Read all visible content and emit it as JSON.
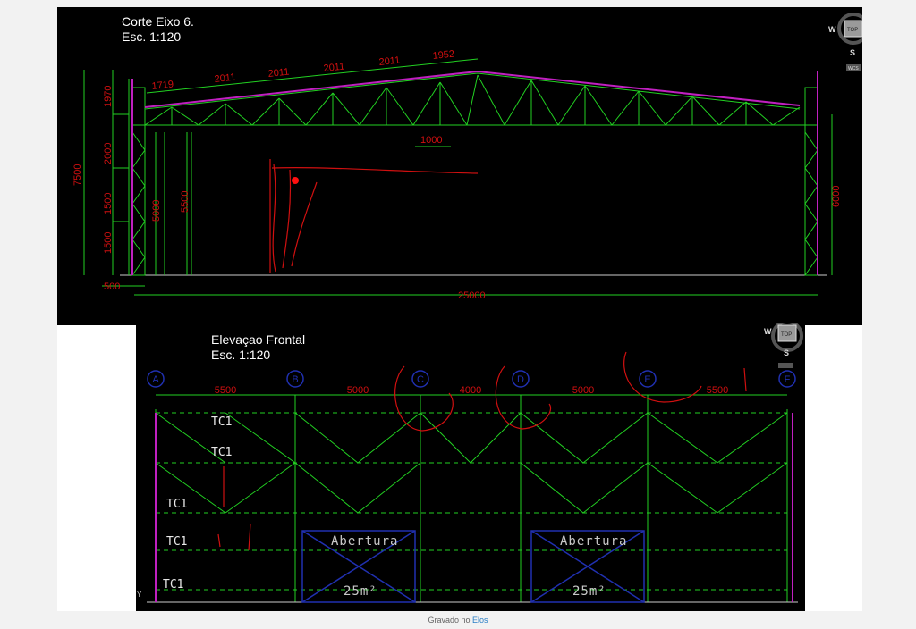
{
  "section": {
    "title": "Corte Eixo 6.",
    "scale": "Esc. 1:120",
    "dims_top": [
      "1719",
      "2011",
      "2011",
      "2011",
      "2011",
      "1952"
    ],
    "dims_left": [
      "1970",
      "2000",
      "1500",
      "1500"
    ],
    "dim_total_height": "7500",
    "dim_5000": "5000",
    "dim_5500": "5500",
    "dim_6000": "6000",
    "dim_1000": "1000",
    "dim_500": "500",
    "dim_25000": "25000"
  },
  "elevation": {
    "title": "Elevaçao Frontal",
    "scale": "Esc. 1:120",
    "axes": [
      "A",
      "B",
      "C",
      "D",
      "E",
      "F"
    ],
    "spans": [
      "5500",
      "5000",
      "4000",
      "5000",
      "5500"
    ],
    "tc_labels": [
      "TC1",
      "TC1",
      "TC1",
      "TC1",
      "TC1"
    ],
    "openings": [
      {
        "label": "Abertura",
        "area": "25m²"
      },
      {
        "label": "Abertura",
        "area": "25m²"
      }
    ],
    "axis_marker": "Y"
  },
  "viewcube": {
    "top": "TOP",
    "west": "W",
    "south": "S",
    "ucs": "WCS"
  },
  "footer": {
    "prefix": "Gravado no",
    "link": "Elos"
  },
  "colors": {
    "green": "#22d022",
    "red": "#d01010",
    "magenta": "#c020c0",
    "blue": "#2030b0",
    "bg": "#000000"
  }
}
